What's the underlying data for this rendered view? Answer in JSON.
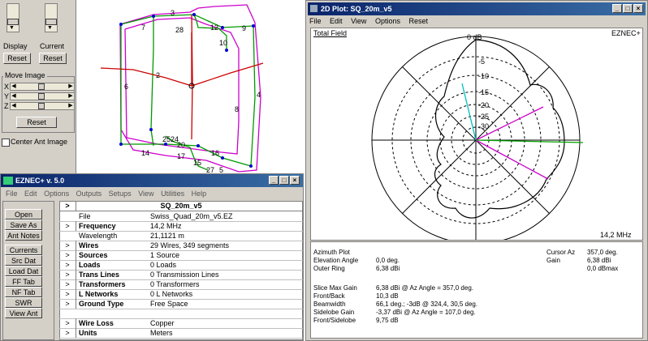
{
  "controls": {
    "display_label": "Display",
    "current_label": "Current",
    "reset_label": "Reset",
    "move_image_label": "Move Image",
    "axis_x": "X",
    "axis_y": "Y",
    "axis_z": "Z",
    "center_ant_label": "Center Ant Image"
  },
  "antenna_view": {
    "wire_numbers": [
      "3",
      "28",
      "12",
      "9",
      "7",
      "10",
      "2",
      "6",
      "8",
      "4",
      "14",
      "25",
      "24",
      "20",
      "17",
      "16",
      "15",
      "27",
      "5"
    ]
  },
  "eznec": {
    "title": "EZNEC+  v. 5.0",
    "menu": [
      "File",
      "Edit",
      "Options",
      "Outputs",
      "Setups",
      "View",
      "Utilities",
      "Help"
    ],
    "buttons": [
      "Open",
      "Save As",
      "Ant Notes",
      "Currents",
      "Src Dat",
      "Load Dat",
      "FF Tab",
      "NF Tab",
      "SWR",
      "View Ant"
    ],
    "header": "SQ_20m_v5",
    "rows": [
      {
        "key": "File",
        "value": "Swiss_Quad_20m_v5.EZ",
        "bold": false,
        "arrow": false
      },
      {
        "key": "Frequency",
        "value": "14,2 MHz",
        "bold": true,
        "arrow": true
      },
      {
        "key": "Wavelength",
        "value": "21,1121 m",
        "bold": false,
        "arrow": false
      },
      {
        "key": "Wires",
        "value": "29 Wires, 349 segments",
        "bold": true,
        "arrow": true
      },
      {
        "key": "Sources",
        "value": "1 Source",
        "bold": true,
        "arrow": true
      },
      {
        "key": "Loads",
        "value": "0 Loads",
        "bold": true,
        "arrow": true
      },
      {
        "key": "Trans Lines",
        "value": "0 Transmission Lines",
        "bold": true,
        "arrow": true
      },
      {
        "key": "Transformers",
        "value": "0 Transformers",
        "bold": true,
        "arrow": true
      },
      {
        "key": "L Networks",
        "value": "0 L Networks",
        "bold": true,
        "arrow": true
      },
      {
        "key": "Ground Type",
        "value": "Free Space",
        "bold": true,
        "arrow": true
      },
      {
        "key": "",
        "value": "",
        "bold": false,
        "arrow": false
      },
      {
        "key": "Wire Loss",
        "value": "Copper",
        "bold": true,
        "arrow": true
      },
      {
        "key": "Units",
        "value": "Meters",
        "bold": true,
        "arrow": true
      }
    ]
  },
  "plot": {
    "title": "2D Plot: SQ_20m_v5",
    "menu": [
      "File",
      "Edit",
      "View",
      "Options",
      "Reset"
    ],
    "total_field": "Total Field",
    "brand": "EZNEC+",
    "frequency": "14,2 MHz",
    "outer_ring_label": "0 dB",
    "ring_labels": [
      "-5",
      "-10",
      "-15",
      "-20",
      "-25",
      "-30"
    ],
    "info": {
      "plot_type": "Azimuth Plot",
      "elevation_label": "Elevation Angle",
      "elevation_value": "0,0 deg.",
      "outer_ring_label": "Outer Ring",
      "outer_ring_value": "6,38 dBi",
      "cursor_az_label": "Cursor Az",
      "cursor_az_value": "357,0 deg.",
      "gain_label": "Gain",
      "gain_value": "6,38 dBi",
      "gain_value2": "0,0 dBmax",
      "slice_label": "Slice Max Gain",
      "slice_value": "6,38 dBi @ Az Angle = 357,0 deg.",
      "fb_label": "Front/Back",
      "fb_value": "10,3 dB",
      "bw_label": "Beamwidth",
      "bw_value": "66,1 deg.; -3dB @ 324,4, 30,5 deg.",
      "sl_label": "Sidelobe Gain",
      "sl_value": "-3,37 dBi @ Az Angle = 107,0 deg.",
      "fs_label": "Front/Sidelobe",
      "fs_value": "9,75 dB"
    }
  }
}
